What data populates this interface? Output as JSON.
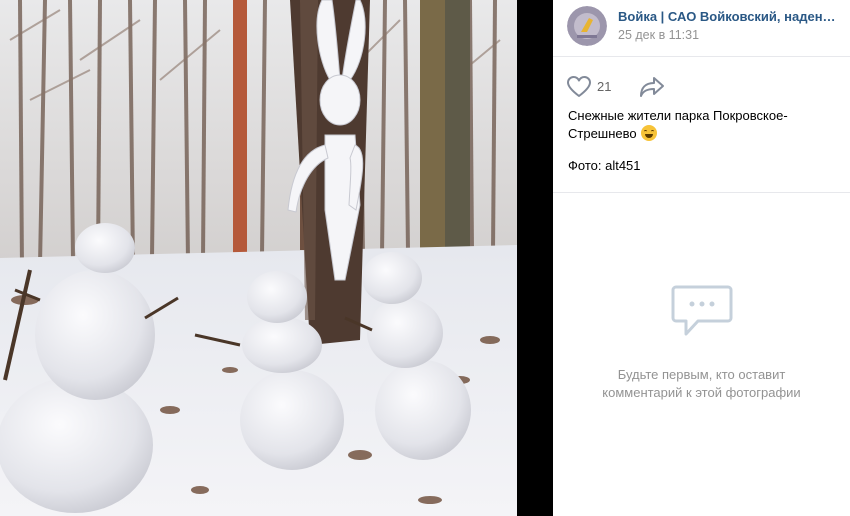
{
  "post": {
    "author": "Войка | САО Войковский, надень м...",
    "date": "25 дек в 11:31",
    "likes": "21",
    "caption": "Снежные жители парка Покровское-Стрешнево",
    "photo_credit": "Фото: alt451"
  },
  "comments": {
    "empty_text_line1": "Будьте первым, кто оставит",
    "empty_text_line2": "комментарий к этой фотографии"
  },
  "icons": {
    "like": "heart-icon",
    "share": "share-arrow-icon",
    "comments_empty": "chat-bubble-icon"
  },
  "colors": {
    "link": "#2a5885",
    "muted": "#939393",
    "divider": "#e7e8ec"
  }
}
